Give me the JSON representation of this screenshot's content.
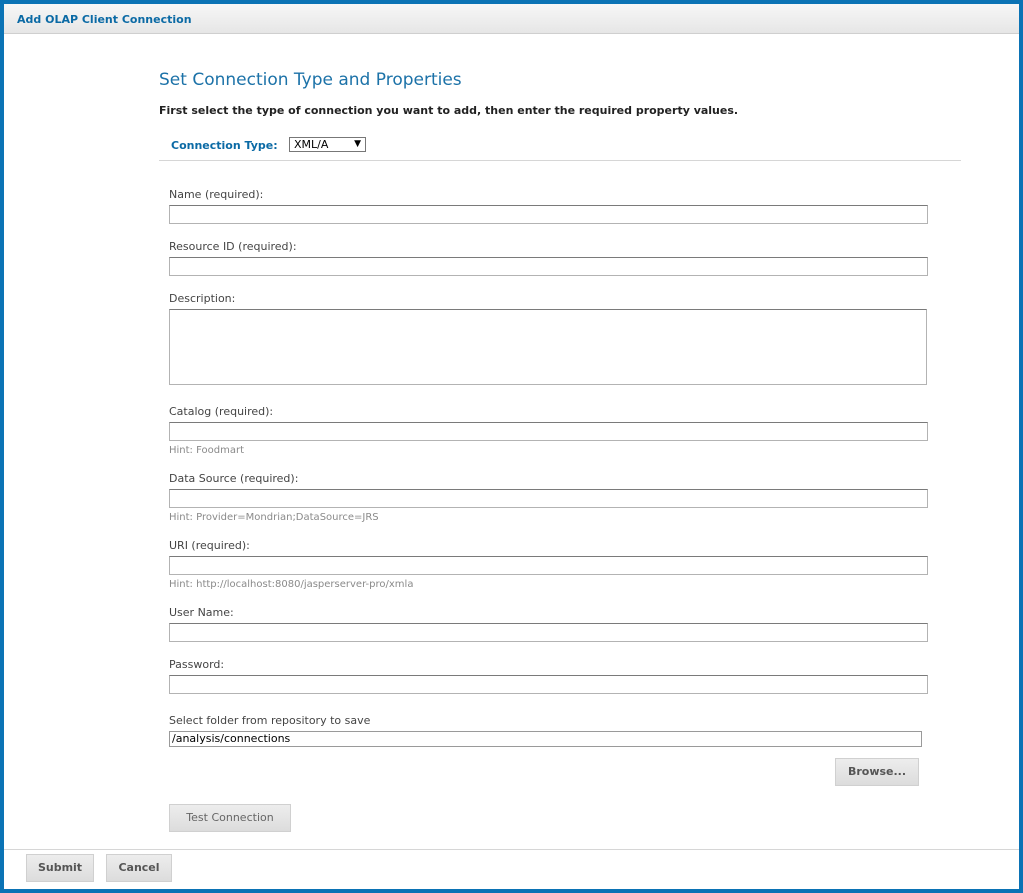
{
  "window": {
    "title": "Add OLAP Client Connection"
  },
  "form": {
    "heading": "Set Connection Type and Properties",
    "instructions": "First select the type of connection you want to add, then enter the required property values.",
    "connection_type": {
      "label": "Connection Type:",
      "value": "XML/A",
      "arrow": "▼"
    },
    "fields": {
      "name": {
        "label": "Name (required):",
        "value": ""
      },
      "resource_id": {
        "label": "Resource ID (required):",
        "value": ""
      },
      "description": {
        "label": "Description:",
        "value": ""
      },
      "catalog": {
        "label": "Catalog (required):",
        "value": "",
        "hint": "Hint: Foodmart"
      },
      "data_source": {
        "label": "Data Source (required):",
        "value": "",
        "hint": "Hint: Provider=Mondrian;DataSource=JRS"
      },
      "uri": {
        "label": "URI (required):",
        "value": "",
        "hint": "Hint: http://localhost:8080/jasperserver-pro/xmla"
      },
      "user_name": {
        "label": "User Name:",
        "value": ""
      },
      "password": {
        "label": "Password:",
        "value": ""
      },
      "folder": {
        "label": "Select folder from repository to save",
        "value": "/analysis/connections"
      }
    },
    "browse_label": "Browse...",
    "test_connection_label": "Test Connection"
  },
  "footer": {
    "submit_label": "Submit",
    "cancel_label": "Cancel"
  },
  "colors": {
    "frame": "#0b73b5",
    "accent": "#1c72a8"
  }
}
